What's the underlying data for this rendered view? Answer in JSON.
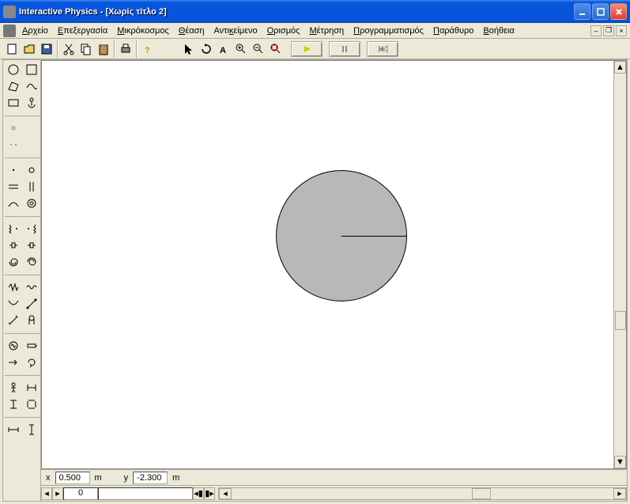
{
  "window": {
    "title": "Interactive Physics - [Χωρίς τίτλο 2]"
  },
  "menu": {
    "file": "Αρχείο",
    "edit": "Επεξεργασία",
    "world": "Μικρόκοσμος",
    "view": "Θέαση",
    "object": "Αντικείμενο",
    "define": "Ορισμός",
    "measure": "Μέτρηση",
    "script": "Προγραμματισμός",
    "windowm": "Παράθυρο",
    "help": "Βοήθεια"
  },
  "status": {
    "xlabel": "x",
    "xval": "0.500",
    "xunit": "m",
    "ylabel": "y",
    "yval": "-2.300",
    "yunit": "m"
  },
  "frame": {
    "value": "0"
  },
  "icons": {
    "new": "new-file-icon",
    "open": "open-file-icon",
    "save": "save-icon",
    "cut": "cut-icon",
    "copy": "copy-icon",
    "paste": "paste-icon",
    "print": "print-icon",
    "help": "help-icon",
    "pointer": "pointer-icon",
    "rotate": "rotate-icon",
    "text": "text-icon",
    "zoomin": "zoom-in-icon",
    "zoomout": "zoom-out-icon",
    "zoomfit": "zoom-fit-icon",
    "run": "play-icon",
    "stop": "pause-icon",
    "reset": "reset-icon"
  }
}
